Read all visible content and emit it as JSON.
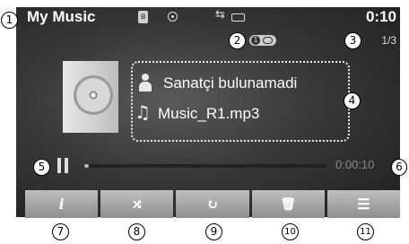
{
  "header": {
    "title": "My Music",
    "clock": "0:10",
    "bluetooth_glyph": "ʙ",
    "usb_glyph": "⇆"
  },
  "status": {
    "repeat_one_badge": "1",
    "track_position": "1/3"
  },
  "now_playing": {
    "artist": "Sanatçi bulunamadi",
    "filename": "Music_R1.mp3",
    "note_glyph": "♫"
  },
  "playback": {
    "elapsed": "0:00:10",
    "progress_fraction": 0.02
  },
  "controls": [
    {
      "icon": "info-icon",
      "glyph": "i"
    },
    {
      "icon": "shuffle-icon",
      "glyph": "⤨"
    },
    {
      "icon": "repeat-icon",
      "glyph": "↻"
    },
    {
      "icon": "delete-icon",
      "glyph": "🗑"
    },
    {
      "icon": "list-icon",
      "glyph": "☰"
    }
  ],
  "callouts": [
    "1",
    "2",
    "3",
    "4",
    "5",
    "6",
    "7",
    "8",
    "9",
    "10",
    "11"
  ],
  "colors": {
    "screen": "#383838",
    "button": "#a6a6a6",
    "time": "#8a8a8a"
  }
}
